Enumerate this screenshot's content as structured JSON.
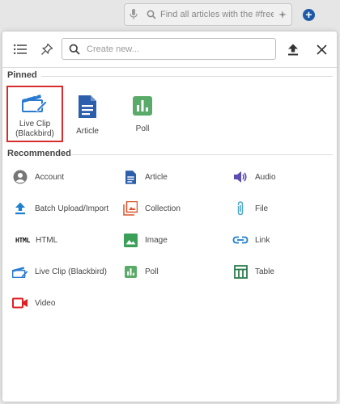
{
  "background": {
    "search_placeholder": "Find all articles with the #free...",
    "add_button": "+"
  },
  "toolbar": {
    "create_placeholder": "Create new..."
  },
  "pinned": {
    "title": "Pinned",
    "items": [
      {
        "label": "Live Clip (Blackbird)",
        "icon": "clapperboard-edit-icon",
        "selected": true
      },
      {
        "label": "Article",
        "icon": "article-icon"
      },
      {
        "label": "Poll",
        "icon": "poll-icon"
      }
    ]
  },
  "recommended": {
    "title": "Recommended",
    "items": [
      {
        "label": "Account",
        "icon": "account-icon"
      },
      {
        "label": "Article",
        "icon": "article-icon"
      },
      {
        "label": "Audio",
        "icon": "audio-icon"
      },
      {
        "label": "Batch Upload/Import",
        "icon": "upload-icon"
      },
      {
        "label": "Collection",
        "icon": "collection-icon"
      },
      {
        "label": "File",
        "icon": "paperclip-icon"
      },
      {
        "label": "HTML",
        "icon": "html-icon"
      },
      {
        "label": "Image",
        "icon": "image-icon"
      },
      {
        "label": "Link",
        "icon": "link-icon"
      },
      {
        "label": "Live Clip (Blackbird)",
        "icon": "clapperboard-edit-icon"
      },
      {
        "label": "Poll",
        "icon": "poll-icon"
      },
      {
        "label": "Table",
        "icon": "table-icon"
      },
      {
        "label": "Video",
        "icon": "video-icon"
      }
    ]
  },
  "colors": {
    "selected_border": "#d92d2d",
    "clip_blue": "#2a7bd0",
    "article_blue": "#2b5eab",
    "poll_green": "#5aab6a",
    "video_red": "#e02020"
  }
}
